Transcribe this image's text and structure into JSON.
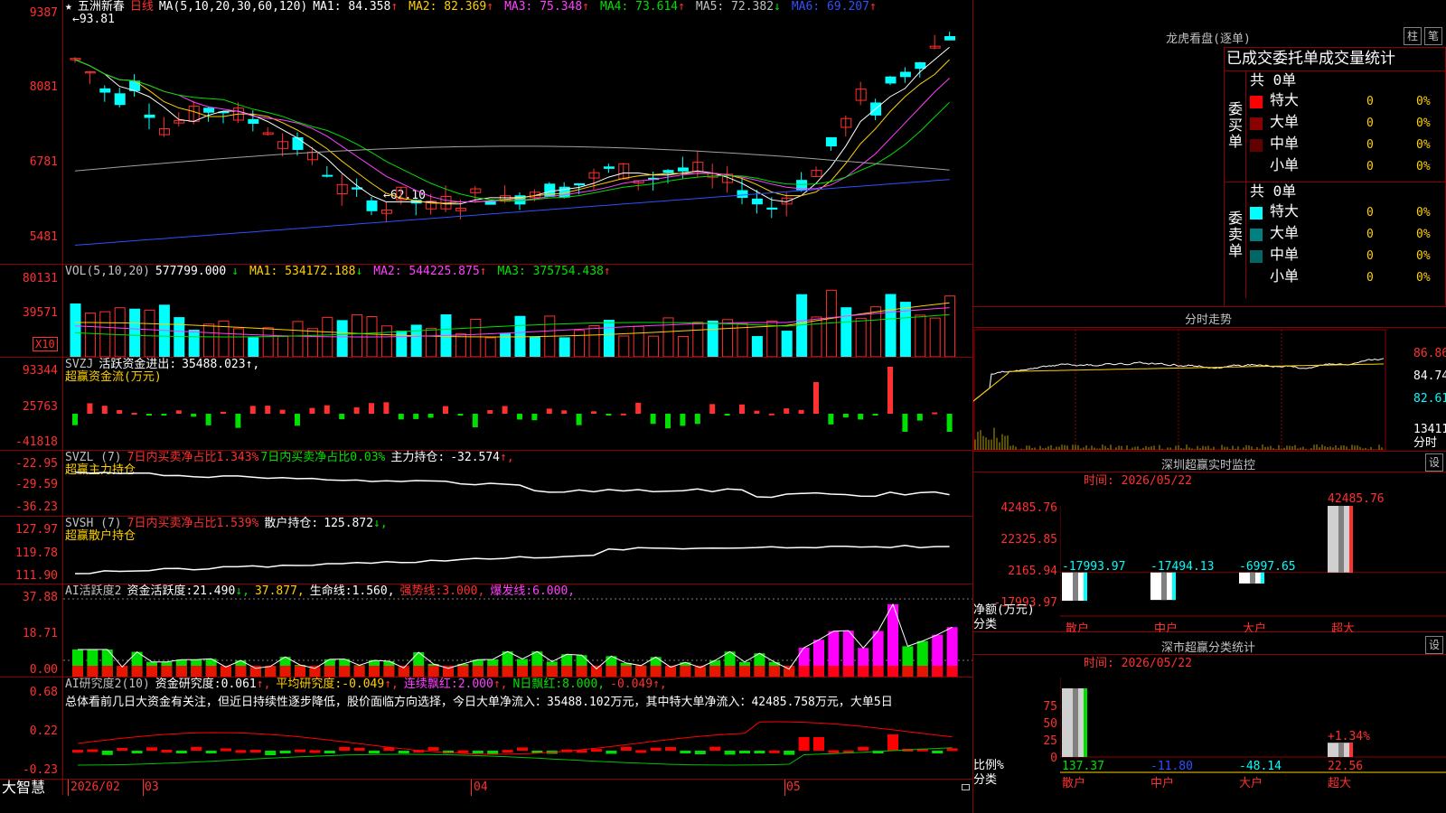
{
  "price": {
    "stock_name": "五洲新春",
    "star": "★",
    "period": "日线",
    "ma_params": "MA(5,10,20,30,60,120)",
    "ma": [
      {
        "label": "MA1:",
        "value": "84.358",
        "arrow": "↑",
        "color": "#ffffff"
      },
      {
        "label": "MA2:",
        "value": "82.369",
        "arrow": "↑",
        "color": "#ffd000"
      },
      {
        "label": "MA3:",
        "value": "75.348",
        "arrow": "↑",
        "color": "#ff40ff"
      },
      {
        "label": "MA4:",
        "value": "73.614",
        "arrow": "↑",
        "color": "#00e000"
      },
      {
        "label": "MA5:",
        "value": "72.382",
        "arrow": "↓",
        "color": "#c0c0c0"
      },
      {
        "label": "MA6:",
        "value": "69.207",
        "arrow": "↑",
        "color": "#3050ff"
      }
    ],
    "yticks": [
      "9387",
      "8081",
      "6781",
      "5481"
    ],
    "high_label": "93.81",
    "low_label": "62.10"
  },
  "vol": {
    "header": "VOL(5,10,20)",
    "value": "577799.000",
    "value_arrow": "↓",
    "ma": [
      {
        "label": "MA1:",
        "value": "534172.188",
        "arrow": "↓",
        "color": "#ffd000"
      },
      {
        "label": "MA2:",
        "value": "544225.875",
        "arrow": "↑",
        "color": "#ff40ff"
      },
      {
        "label": "MA3:",
        "value": "375754.438",
        "arrow": "↑",
        "color": "#00e000"
      }
    ],
    "yticks": [
      "80131",
      "39571"
    ],
    "unit": "X10"
  },
  "svzj": {
    "header": "SVZJ",
    "label": "活跃资金进出:",
    "value": "35488.023",
    "arrow": "↑,",
    "subtitle": "超赢资金流(万元)",
    "yticks": [
      "93344",
      "25763",
      "-41818"
    ]
  },
  "svzl": {
    "header": "SVZL (7)",
    "red_text": "7日内买卖净占比1.343%",
    "green_text": "7日内买卖净占比0.03%",
    "main_label": "主力持仓:",
    "main_value": "-32.574",
    "arrow": "↑,",
    "subtitle": "超赢主力持仓",
    "yticks": [
      "-22.95",
      "-29.59",
      "-36.23"
    ]
  },
  "svsh": {
    "header": "SVSH (7)",
    "red_text": "7日内买卖净占比1.539%",
    "retail_label": "散户持仓:",
    "retail_value": "125.872",
    "arrow": "↓,",
    "subtitle": "超赢散户持仓",
    "yticks": [
      "127.97",
      "119.78",
      "111.90"
    ]
  },
  "ai_act": {
    "header": "AI活跃度2",
    "l1": "资金活跃度:",
    "v1": "21.490",
    "a1": "↓,",
    "v2": "37.877,",
    "l3": "生命线:",
    "v3": "1.560,",
    "l4": "强势线:",
    "v4": "3.000,",
    "l5": "爆发线:",
    "v5": "6.000,",
    "yticks": [
      "37.88",
      "18.71",
      "0.00"
    ]
  },
  "ai_res": {
    "header": "AI研究度2(10)",
    "l1": "资金研究度:",
    "v1": "0.061",
    "a1": "↑,",
    "l2": "平均研究度:",
    "v2": "-0.049",
    "a2": "↑,",
    "l3": "连续飘红:",
    "v3": "2.000",
    "a3": "↑,",
    "l4": "N日飘红:",
    "v4": "8.000,",
    "v5": "-0.049",
    "a5": "↑,",
    "commentary": "总体看前几日大资金有关注，但近日持续性逐步降低，股价面临方向选择，今日大单净流入：35488.102万元，其中特大单净流入：42485.758万元，大单5日",
    "yticks": [
      "0.68",
      "0.22",
      "-0.23"
    ]
  },
  "bottom": {
    "brand": "大智慧",
    "dates": [
      "2026/02",
      "03",
      "04",
      "05"
    ]
  },
  "lhb": {
    "title": "龙虎看盘(逐单)",
    "btn1": "柱",
    "btn2": "笔",
    "tabs_text": "已成交委托单成交量统计",
    "buy": {
      "side_label": "委买单",
      "total": "共 0单",
      "rows": [
        {
          "name": "特大",
          "count": "0",
          "pct": "0%",
          "color": "#ff0000"
        },
        {
          "name": "大单",
          "count": "0",
          "pct": "0%",
          "color": "#8b0000"
        },
        {
          "name": "中单",
          "count": "0",
          "pct": "0%",
          "color": "#600000"
        },
        {
          "name": "小单",
          "count": "0",
          "pct": "0%",
          "color": ""
        }
      ]
    },
    "sell": {
      "side_label": "委卖单",
      "total": "共 0单",
      "rows": [
        {
          "name": "特大",
          "count": "0",
          "pct": "0%",
          "color": "#00ffff"
        },
        {
          "name": "大单",
          "count": "0",
          "pct": "0%",
          "color": "#008080"
        },
        {
          "name": "中单",
          "count": "0",
          "pct": "0%",
          "color": "#006666"
        },
        {
          "name": "小单",
          "count": "0",
          "pct": "0%",
          "color": ""
        }
      ]
    }
  },
  "intraday": {
    "title": "分时走势",
    "yticks": [
      "86.86",
      "84.74",
      "82.61"
    ],
    "vol_tick": "13411",
    "unit": "分时"
  },
  "monitor": {
    "title": "深圳超赢实时监控",
    "btn": "设",
    "time": "时间: 2026/05/22",
    "yticks": [
      "42485.76",
      "22325.85",
      "2165.94",
      "-17993.97"
    ],
    "axis_label1": "净额(万元)",
    "axis_label2": "分类",
    "categories": [
      "散户",
      "中户",
      "大户",
      "超大"
    ],
    "values": [
      "-17993.97",
      "-17494.13",
      "-6997.65",
      "42485.76"
    ]
  },
  "classify": {
    "title": "深市超赢分类统计",
    "btn": "设",
    "time": "时间: 2026/05/22",
    "yticks": [
      "75",
      "50",
      "25",
      "0"
    ],
    "axis_label1": "比例%",
    "axis_label2": "分类",
    "categories": [
      "散户",
      "中户",
      "大户",
      "超大"
    ],
    "values": [
      "137.37",
      "-11.80",
      "-48.14",
      "22.56"
    ],
    "bar_label": "+1.34%"
  }
}
